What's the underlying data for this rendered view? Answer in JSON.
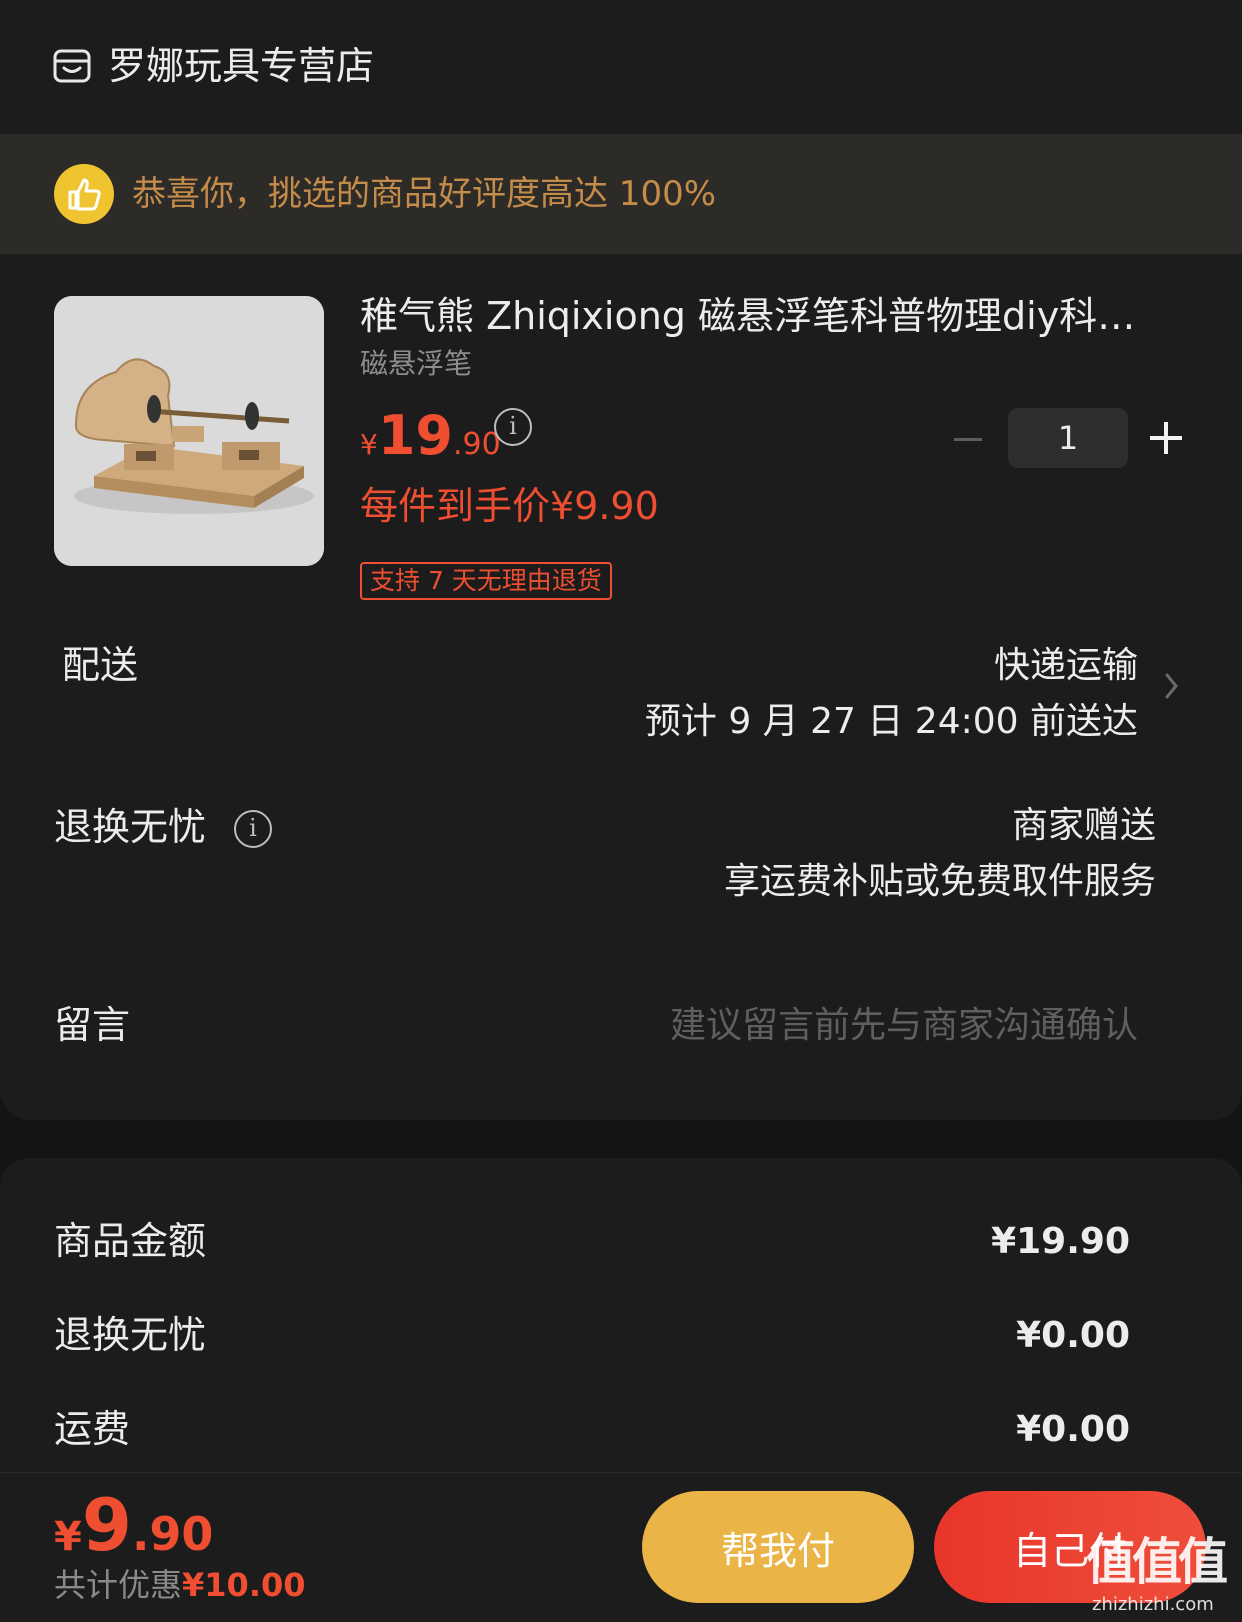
{
  "store": {
    "name": "罗娜玩具专营店",
    "icon": "store-icon"
  },
  "banner": {
    "icon": "thumbs-up-icon",
    "text": "恭喜你，挑选的商品好评度高达 100%"
  },
  "product": {
    "title": "稚气熊 Zhiqixiong  磁悬浮笔科普物理diy科技小制作",
    "spec": "磁悬浮笔",
    "price_symbol": "¥",
    "price_int": "19",
    "price_dec": ".90",
    "quantity": "1",
    "unit_price": "每件到手价¥9.90",
    "return_tag": "支持 7 天无理由退货"
  },
  "delivery": {
    "label": "配送",
    "method": "快递运输",
    "eta": "预计 9 月 27 日 24:00 前送达"
  },
  "worry_free": {
    "label": "退换无忧",
    "value": "商家赠送",
    "desc": "享运费补贴或免费取件服务"
  },
  "message": {
    "label": "留言",
    "placeholder": "建议留言前先与商家沟通确认"
  },
  "summary": {
    "items": [
      {
        "label": "商品金额",
        "value": "¥19.90"
      },
      {
        "label": "退换无忧",
        "value": "¥0.00"
      },
      {
        "label": "运费",
        "value": "¥0.00"
      }
    ]
  },
  "footer": {
    "total_symbol": "¥",
    "total_int": "9",
    "total_dec": ".90",
    "discount_label": "共计优惠",
    "discount_amount": "¥10.00",
    "help_pay": "帮我付",
    "self_pay": "自己付"
  },
  "watermark": {
    "logo": "值值值",
    "url": "zhizhizhi.com"
  },
  "colors": {
    "accent_red": "#f04e31",
    "gold": "#eab446",
    "banner_text": "#c58b49"
  }
}
